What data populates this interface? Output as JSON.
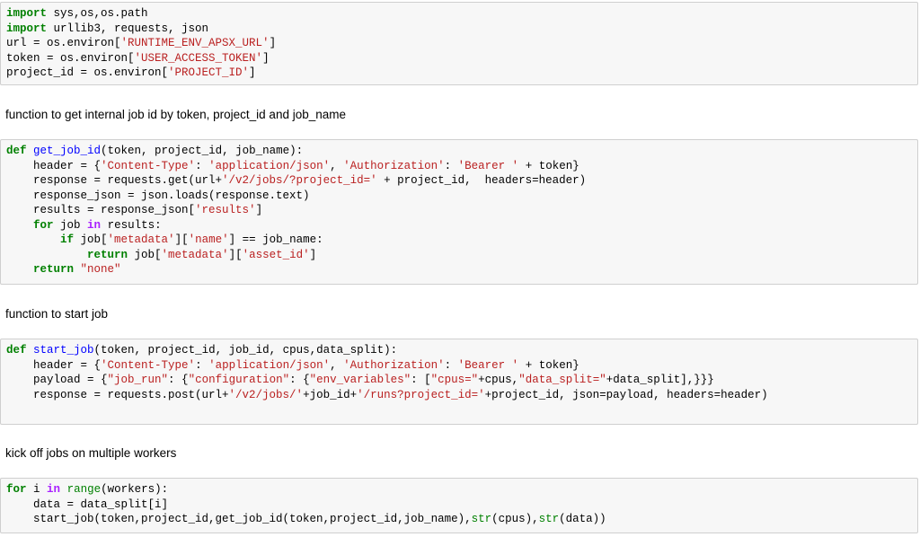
{
  "cells": [
    {
      "type": "code",
      "lines": [
        [
          [
            "kw",
            "import"
          ],
          [
            "t",
            " sys,os,os.path"
          ]
        ],
        [
          [
            "kw",
            "import"
          ],
          [
            "t",
            " urllib3, requests, json"
          ]
        ],
        [
          [
            "t",
            "url = os.environ["
          ],
          [
            "st",
            "'RUNTIME_ENV_APSX_URL'"
          ],
          [
            "t",
            "]"
          ]
        ],
        [
          [
            "t",
            "token = os.environ["
          ],
          [
            "st",
            "'USER_ACCESS_TOKEN'"
          ],
          [
            "t",
            "]"
          ]
        ],
        [
          [
            "t",
            "project_id = os.environ["
          ],
          [
            "st",
            "'PROJECT_ID'"
          ],
          [
            "t",
            "]"
          ]
        ]
      ]
    },
    {
      "type": "markdown",
      "text": "function to get internal job id by token, project_id and job_name"
    },
    {
      "type": "code",
      "lines": [
        [
          [
            "kw",
            "def"
          ],
          [
            "t",
            " "
          ],
          [
            "fn",
            "get_job_id"
          ],
          [
            "t",
            "(token, project_id, job_name):"
          ]
        ],
        [
          [
            "t",
            "    header = {"
          ],
          [
            "st",
            "'Content-Type'"
          ],
          [
            "t",
            ": "
          ],
          [
            "st",
            "'application/json'"
          ],
          [
            "t",
            ", "
          ],
          [
            "st",
            "'Authorization'"
          ],
          [
            "t",
            ": "
          ],
          [
            "st",
            "'Bearer '"
          ],
          [
            "t",
            " + token}"
          ]
        ],
        [
          [
            "t",
            "    response = requests.get(url+"
          ],
          [
            "st",
            "'/v2/jobs/?project_id='"
          ],
          [
            "t",
            " + project_id,  headers=header)"
          ]
        ],
        [
          [
            "t",
            "    response_json = json.loads(response.text)"
          ]
        ],
        [
          [
            "t",
            "    results = response_json["
          ],
          [
            "st",
            "'results'"
          ],
          [
            "t",
            "]"
          ]
        ],
        [
          [
            "t",
            "    "
          ],
          [
            "kw",
            "for"
          ],
          [
            "t",
            " job "
          ],
          [
            "op",
            "in"
          ],
          [
            "t",
            " results:"
          ]
        ],
        [
          [
            "t",
            "        "
          ],
          [
            "kw",
            "if"
          ],
          [
            "t",
            " job["
          ],
          [
            "st",
            "'metadata'"
          ],
          [
            "t",
            "]["
          ],
          [
            "st",
            "'name'"
          ],
          [
            "t",
            "] == job_name:"
          ]
        ],
        [
          [
            "t",
            "            "
          ],
          [
            "kw",
            "return"
          ],
          [
            "t",
            " job["
          ],
          [
            "st",
            "'metadata'"
          ],
          [
            "t",
            "]["
          ],
          [
            "st",
            "'asset_id'"
          ],
          [
            "t",
            "]"
          ]
        ],
        [
          [
            "t",
            "    "
          ],
          [
            "kw",
            "return"
          ],
          [
            "t",
            " "
          ],
          [
            "st",
            "\"none\""
          ]
        ]
      ]
    },
    {
      "type": "markdown",
      "text": "function to start job"
    },
    {
      "type": "code",
      "lines": [
        [
          [
            "kw",
            "def"
          ],
          [
            "t",
            " "
          ],
          [
            "fn",
            "start_job"
          ],
          [
            "t",
            "(token, project_id, job_id, cpus,data_split):"
          ]
        ],
        [
          [
            "t",
            "    header = {"
          ],
          [
            "st",
            "'Content-Type'"
          ],
          [
            "t",
            ": "
          ],
          [
            "st",
            "'application/json'"
          ],
          [
            "t",
            ", "
          ],
          [
            "st",
            "'Authorization'"
          ],
          [
            "t",
            ": "
          ],
          [
            "st",
            "'Bearer '"
          ],
          [
            "t",
            " + token}"
          ]
        ],
        [
          [
            "t",
            "    payload = {"
          ],
          [
            "st",
            "\"job_run\""
          ],
          [
            "t",
            ": {"
          ],
          [
            "st",
            "\"configuration\""
          ],
          [
            "t",
            ": {"
          ],
          [
            "st",
            "\"env_variables\""
          ],
          [
            "t",
            ": ["
          ],
          [
            "st",
            "\"cpus=\""
          ],
          [
            "t",
            "+cpus,"
          ],
          [
            "st",
            "\"data_split=\""
          ],
          [
            "t",
            "+data_split],}}}"
          ]
        ],
        [
          [
            "t",
            "    response = requests.post(url+"
          ],
          [
            "st",
            "'/v2/jobs/'"
          ],
          [
            "t",
            "+job_id+"
          ],
          [
            "st",
            "'/runs?project_id='"
          ],
          [
            "t",
            "+project_id, json=payload, headers=header)"
          ]
        ],
        [
          [
            "t",
            ""
          ]
        ]
      ]
    },
    {
      "type": "markdown",
      "text": "kick off jobs on multiple workers"
    },
    {
      "type": "code",
      "lines": [
        [
          [
            "kw",
            "for"
          ],
          [
            "t",
            " i "
          ],
          [
            "op",
            "in"
          ],
          [
            "t",
            " "
          ],
          [
            "bi",
            "range"
          ],
          [
            "t",
            "(workers):"
          ]
        ],
        [
          [
            "t",
            "    data = data_split[i]"
          ]
        ],
        [
          [
            "t",
            "    start_job(token,project_id,get_job_id(token,project_id,job_name),"
          ],
          [
            "bi",
            "str"
          ],
          [
            "t",
            "(cpus),"
          ],
          [
            "bi",
            "str"
          ],
          [
            "t",
            "(data))"
          ]
        ]
      ]
    }
  ]
}
